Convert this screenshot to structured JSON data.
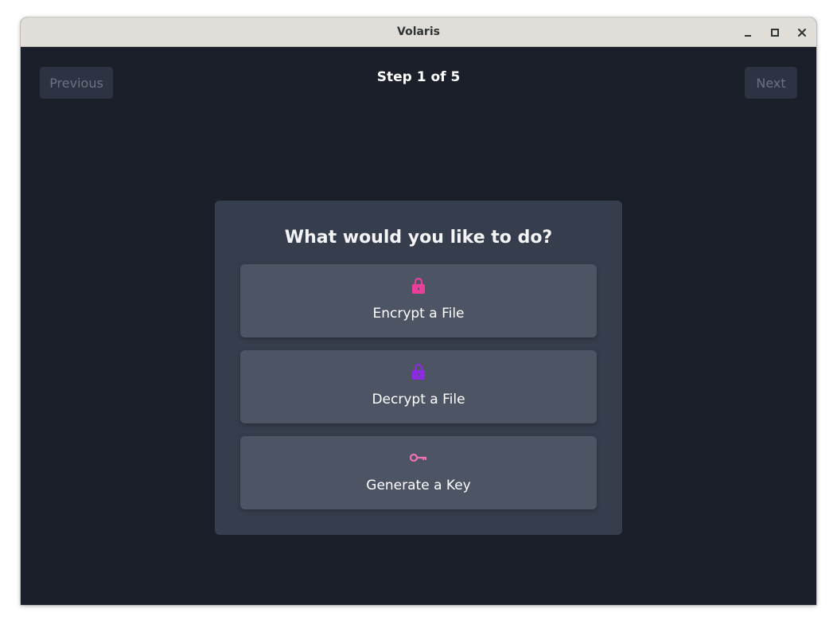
{
  "window": {
    "title": "Volaris",
    "controls": [
      "minimize-icon",
      "maximize-icon",
      "close-icon"
    ]
  },
  "nav": {
    "previous_label": "Previous",
    "next_label": "Next",
    "step_label": "Step 1 of 5"
  },
  "wizard": {
    "question": "What would you like to do?",
    "options": [
      {
        "label": "Encrypt a File",
        "icon": "lock-icon",
        "icon_color": "#e8409a"
      },
      {
        "label": "Decrypt a File",
        "icon": "unlock-icon",
        "icon_color": "#8c2ce0"
      },
      {
        "label": "Generate a Key",
        "icon": "key-icon",
        "icon_color": "#f070b8"
      }
    ]
  },
  "colors": {
    "background": "#1b1f2a",
    "card": "#363d4d",
    "option": "#4d5564",
    "titlebar": "#e1ddd9"
  }
}
